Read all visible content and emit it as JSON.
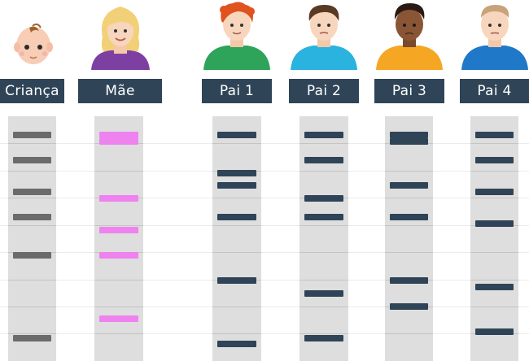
{
  "columns": [
    {
      "id": "crianca",
      "label": "Criança",
      "avatar": "baby-icon",
      "band_color": "#6b6b6b",
      "bands": [
        1,
        5,
        10,
        14,
        20,
        33
      ]
    },
    {
      "id": "mae",
      "label": "Mãe",
      "avatar": "woman-icon",
      "band_color": "#ee82ee",
      "bands": [
        1,
        2,
        11,
        16,
        20,
        30
      ]
    },
    {
      "id": "pai1",
      "label": "Pai 1",
      "avatar": "man-red-hair-icon",
      "band_color": "#2f4457",
      "bands": [
        1,
        7,
        9,
        14,
        24,
        34
      ]
    },
    {
      "id": "pai2",
      "label": "Pai 2",
      "avatar": "man-brown-hair-icon",
      "band_color": "#2f4457",
      "bands": [
        1,
        5,
        11,
        14,
        26,
        33
      ]
    },
    {
      "id": "pai3",
      "label": "Pai 3",
      "avatar": "man-dark-skin-icon",
      "band_color": "#2f4457",
      "bands": [
        1,
        2,
        9,
        14,
        24,
        28
      ]
    },
    {
      "id": "pai4",
      "label": "Pai 4",
      "avatar": "man-blond-hair-icon",
      "band_color": "#2f4457",
      "bands": [
        1,
        5,
        10,
        15,
        25,
        32
      ]
    }
  ]
}
